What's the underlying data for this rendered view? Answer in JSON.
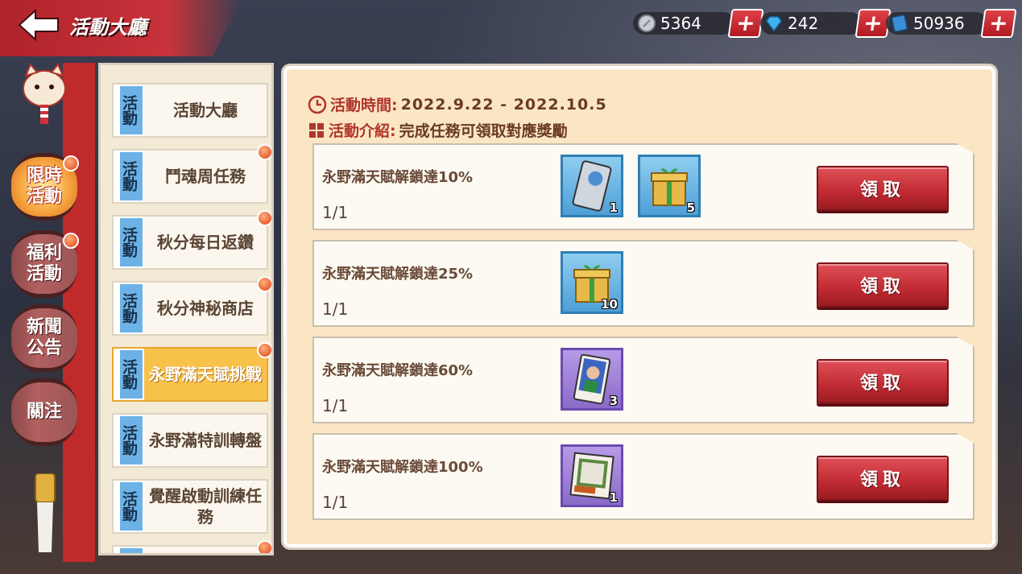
{
  "header": {
    "title": "活動大廳"
  },
  "currencies": [
    {
      "name": "silver-coin",
      "value": "5364"
    },
    {
      "name": "diamond",
      "value": "242"
    },
    {
      "name": "card-ticket",
      "value": "50936"
    }
  ],
  "nav": [
    {
      "label": "限時\n活動",
      "active": true,
      "dot": true
    },
    {
      "label": "福利\n活動",
      "active": false,
      "dot": true
    },
    {
      "label": "新聞\n公告",
      "active": false,
      "dot": false
    },
    {
      "label": "關注",
      "active": false,
      "dot": false
    }
  ],
  "activities": [
    {
      "tag": "活動",
      "label": "活動大廳",
      "active": false,
      "dot": false
    },
    {
      "tag": "活動",
      "label": "鬥魂周任務",
      "active": false,
      "dot": true
    },
    {
      "tag": "活動",
      "label": "秋分每日返鑽",
      "active": false,
      "dot": true
    },
    {
      "tag": "活動",
      "label": "秋分神秘商店",
      "active": false,
      "dot": true
    },
    {
      "tag": "活動",
      "label": "永野滿天賦挑戰",
      "active": true,
      "dot": true
    },
    {
      "tag": "活動",
      "label": "永野滿特訓轉盤",
      "active": false,
      "dot": false
    },
    {
      "tag": "活動",
      "label": "覺醒啟動訓練任務",
      "active": false,
      "dot": false
    },
    {
      "tag": "活動",
      "label": "",
      "active": false,
      "dot": true
    }
  ],
  "event": {
    "time_label": "活動時間:",
    "time_value": "2022.9.22 - 2022.10.5",
    "intro_label": "活動介紹:",
    "intro_value": "完成任務可領取對應獎勵"
  },
  "tasks": [
    {
      "title": "永野滿天賦解鎖達10%",
      "progress": "1/1",
      "claim": "領取",
      "rewards": [
        {
          "icon": "platinum-card-icon",
          "qty": "1",
          "style": "blue"
        },
        {
          "icon": "gift-box-icon",
          "qty": "5",
          "style": "blue"
        }
      ]
    },
    {
      "title": "永野滿天賦解鎖達25%",
      "progress": "1/1",
      "claim": "領取",
      "rewards": [
        {
          "icon": "gift-box-icon",
          "qty": "10",
          "style": "blue"
        }
      ]
    },
    {
      "title": "永野滿天賦解鎖達60%",
      "progress": "1/1",
      "claim": "領取",
      "rewards": [
        {
          "icon": "player-card-icon",
          "qty": "3",
          "style": "purple"
        }
      ]
    },
    {
      "title": "永野滿天賦解鎖達100%",
      "progress": "1/1",
      "claim": "領取",
      "rewards": [
        {
          "icon": "photo-frame-icon",
          "qty": "1",
          "style": "purple"
        }
      ]
    }
  ]
}
